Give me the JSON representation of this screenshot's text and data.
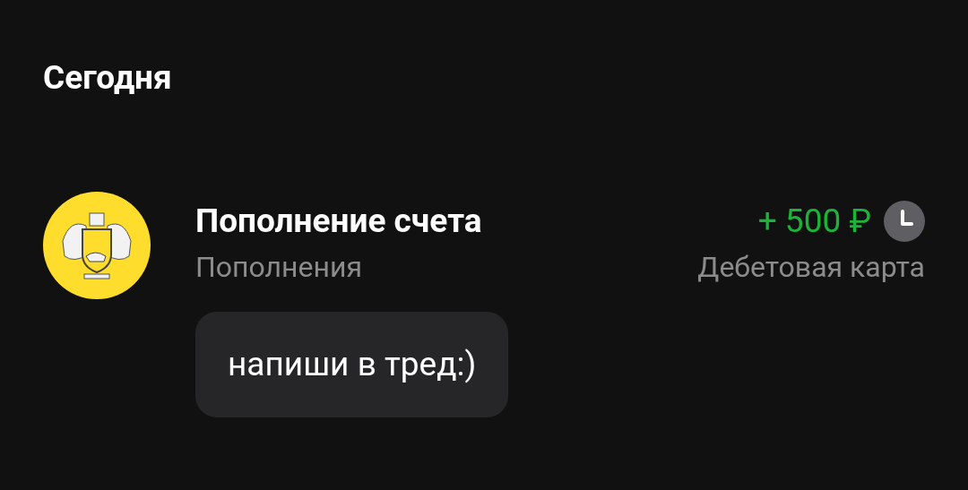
{
  "section_title": "Сегодня",
  "operation": {
    "title": "Пополнение счета",
    "category": "Пополнения",
    "amount": "+ 500 ₽",
    "account": "Дебетовая карта",
    "pending": true,
    "comment": "напиши в тред:)"
  }
}
